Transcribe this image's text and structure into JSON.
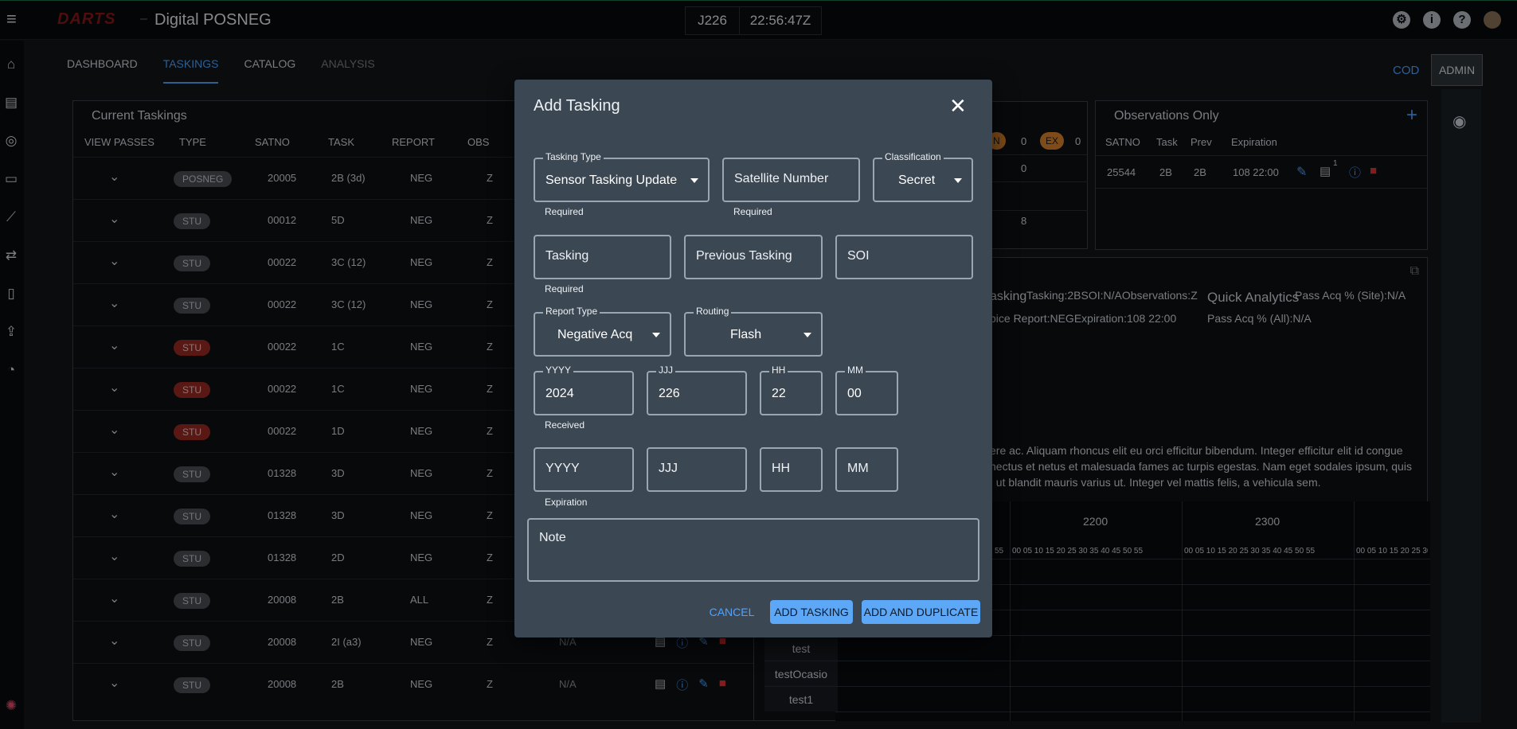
{
  "app": {
    "logo": "DARTS",
    "title": "Digital POSNEG",
    "day": "J226",
    "time": "22:56:47Z"
  },
  "tabs": [
    {
      "label": "DASHBOARD"
    },
    {
      "label": "TASKINGS"
    },
    {
      "label": "CATALOG"
    },
    {
      "label": "ANALYSIS"
    }
  ],
  "header_right": {
    "cod": "COD",
    "admin": "ADMIN"
  },
  "current_taskings": {
    "title": "Current Taskings",
    "columns": [
      "VIEW PASSES",
      "TYPE",
      "SATNO",
      "TASK",
      "REPORT",
      "OBS"
    ],
    "rows": [
      {
        "type": "POSNEG",
        "satno": "20005",
        "task": "2B (3d)",
        "report": "NEG",
        "obs": "Z",
        "type_color": "grey"
      },
      {
        "type": "STU",
        "satno": "00012",
        "task": "5D",
        "report": "NEG",
        "obs": "Z",
        "type_color": "grey"
      },
      {
        "type": "STU",
        "satno": "00022",
        "task": "3C (12)",
        "report": "NEG",
        "obs": "Z",
        "type_color": "grey"
      },
      {
        "type": "STU",
        "satno": "00022",
        "task": "3C (12)",
        "report": "NEG",
        "obs": "Z",
        "type_color": "grey"
      },
      {
        "type": "STU",
        "satno": "00022",
        "task": "1C",
        "report": "NEG",
        "obs": "Z",
        "type_color": "red"
      },
      {
        "type": "STU",
        "satno": "00022",
        "task": "1C",
        "report": "NEG",
        "obs": "Z",
        "type_color": "red"
      },
      {
        "type": "STU",
        "satno": "00022",
        "task": "1D",
        "report": "NEG",
        "obs": "Z",
        "type_color": "red"
      },
      {
        "type": "STU",
        "satno": "01328",
        "task": "3D",
        "report": "NEG",
        "obs": "Z",
        "type_color": "grey"
      },
      {
        "type": "STU",
        "satno": "01328",
        "task": "3D",
        "report": "NEG",
        "obs": "Z",
        "type_color": "grey"
      },
      {
        "type": "STU",
        "satno": "01328",
        "task": "2D",
        "report": "NEG",
        "obs": "Z",
        "type_color": "grey"
      },
      {
        "type": "STU",
        "satno": "20008",
        "task": "2B",
        "report": "ALL",
        "obs": "Z",
        "type_color": "grey"
      },
      {
        "type": "STU",
        "satno": "20008",
        "task": "2I (a3)",
        "report": "NEG",
        "obs": "Z",
        "type_color": "grey",
        "extra": "N/A"
      },
      {
        "type": "STU",
        "satno": "20008",
        "task": "2B",
        "report": "NEG",
        "obs": "Z",
        "type_color": "grey",
        "extra": "N/A"
      }
    ]
  },
  "status_counts": {
    "n_label": "N",
    "n_value": "0",
    "ex_label": "EX",
    "ex_value": "0",
    "row2_value": "0",
    "row3_value": "8"
  },
  "observations_only": {
    "title": "Observations Only",
    "columns": [
      "SATNO",
      "Task",
      "Prev",
      "Expiration"
    ],
    "rows": [
      {
        "satno": "25544",
        "task": "2B",
        "prev": "2B",
        "expiration": "108 22:00",
        "note_count": "1"
      }
    ]
  },
  "detail": {
    "line1a": "asking",
    "line1b": "Tasking:2BSOI:N/AObservations:Z",
    "line2": "pice Report:NEGExpiration:108 22:00",
    "qa_title": "Quick Analytics",
    "qa_site": "Pass Acq % (Site):N/A",
    "qa_all": "Pass Acq % (All):N/A",
    "lorem1": "ere ac. Aliquam rhoncus elit eu orci efficitur bibendum. Integer efficitur elit id congue",
    "lorem2": "nectus et netus et malesuada fames ac turpis egestas. Nam eget sodales ipsum, quis",
    "lorem3": ", ut blandit mauris varius ut. Integer vel mattis felis, a vehicula sem."
  },
  "timeline": {
    "hours": [
      "2200",
      "2300"
    ],
    "minutes": "00 05 10 15 20 25 30 35 40 45 50 55",
    "names": [
      "test",
      "testOcasio",
      "test1"
    ]
  },
  "modal": {
    "title": "Add Tasking",
    "tasking_type": {
      "label": "Tasking Type",
      "value": "Sensor Tasking Update",
      "helper": "Required"
    },
    "satellite_number": {
      "placeholder": "Satellite Number",
      "helper": "Required"
    },
    "classification": {
      "label": "Classification",
      "value": "Secret"
    },
    "tasking": {
      "placeholder": "Tasking",
      "helper": "Required"
    },
    "previous_tasking": {
      "placeholder": "Previous Tasking"
    },
    "soi": {
      "placeholder": "SOI"
    },
    "report_type": {
      "label": "Report Type",
      "value": "Negative Acq"
    },
    "routing": {
      "label": "Routing",
      "value": "Flash"
    },
    "received": {
      "yyyy_label": "YYYY",
      "yyyy": "2024",
      "jjj_label": "JJJ",
      "jjj": "226",
      "hh_label": "HH",
      "hh": "22",
      "mm_label": "MM",
      "mm": "00",
      "helper": "Received"
    },
    "expiration": {
      "yyyy": "YYYY",
      "jjj": "JJJ",
      "hh": "HH",
      "mm": "MM",
      "helper": "Expiration"
    },
    "note": {
      "placeholder": "Note"
    },
    "buttons": {
      "cancel": "CANCEL",
      "add": "ADD TASKING",
      "add_dup": "ADD AND DUPLICATE"
    }
  }
}
